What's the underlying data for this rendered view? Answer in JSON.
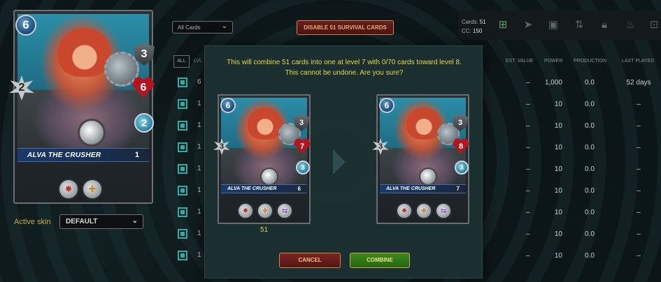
{
  "card_panel": {
    "card_name": "ALVA THE CRUSHER",
    "level": "1",
    "mana": "6",
    "armor": "3",
    "melee": "2",
    "health": "6",
    "speed": "2",
    "abilities": [
      "rage-icon",
      "heal-icon"
    ],
    "active_skin_label": "Active skin",
    "skin_value": "DEFAULT"
  },
  "toolbar": {
    "filter_value": "All Cards",
    "disable_button": "DISABLE 51 SURVIVAL CARDS",
    "cards_label": "Cards:",
    "cards_value": "51",
    "cc_label": "CC:",
    "cc_value": "150",
    "icons": [
      "combine-icon",
      "send-icon",
      "market-icon",
      "transfer-icon",
      "lock-icon",
      "burn-icon",
      "delegate-icon"
    ]
  },
  "table": {
    "all_label": "ALL",
    "lvl_header": "LVL",
    "headers": {
      "est_value": "EST. VALUE",
      "power": "POWER",
      "production": "PRODUCTION",
      "last_played": "LAST PLAYED"
    },
    "rows": [
      {
        "lvl": "6",
        "est": "–",
        "power": "1,000",
        "prod": "0.0",
        "last": "52 days"
      },
      {
        "lvl": "1",
        "est": "–",
        "power": "10",
        "prod": "0.0",
        "last": "–"
      },
      {
        "lvl": "1",
        "est": "–",
        "power": "10",
        "prod": "0.0",
        "last": "–"
      },
      {
        "lvl": "1",
        "est": "–",
        "power": "10",
        "prod": "0.0",
        "last": "–"
      },
      {
        "lvl": "1",
        "est": "–",
        "power": "10",
        "prod": "0.0",
        "last": "–"
      },
      {
        "lvl": "1",
        "est": "–",
        "power": "10",
        "prod": "0.0",
        "last": "–"
      },
      {
        "lvl": "1",
        "est": "–",
        "power": "10",
        "prod": "0.0",
        "last": "–"
      },
      {
        "lvl": "1",
        "est": "–",
        "power": "10",
        "prod": "0.0",
        "last": "–"
      },
      {
        "lvl": "1",
        "est": "–",
        "power": "10",
        "prod": "0.0",
        "last": "–"
      }
    ]
  },
  "modal": {
    "message_line1": "This will combine 51 cards into one at level 7 with 0/70 cards toward level 8.",
    "message_line2": "This cannot be undone. Are you sure?",
    "from_card": {
      "name": "ALVA THE CRUSHER",
      "level": "6",
      "mana": "6",
      "armor": "3",
      "melee": "3",
      "health": "7",
      "speed": "3",
      "count": "51"
    },
    "to_card": {
      "name": "ALVA THE CRUSHER",
      "level": "7",
      "mana": "6",
      "armor": "3",
      "melee": "3",
      "health": "8",
      "speed": "3"
    },
    "ability_icons": [
      "rage-icon",
      "heal-icon",
      "swap-icon"
    ],
    "cancel_label": "CANCEL",
    "combine_label": "COMBINE"
  }
}
